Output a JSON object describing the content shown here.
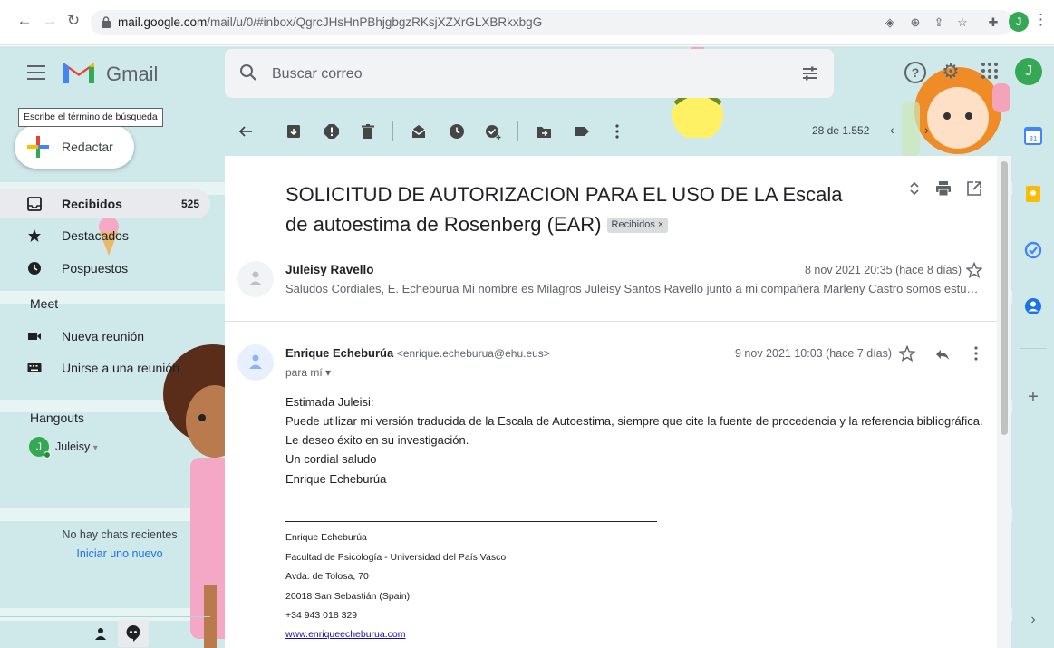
{
  "browser": {
    "url_host": "mail.google.com",
    "url_path": "/mail/u/0/#inbox/QgrcJHsHnPBhjgbgzRKsjXZXrGLXBRkxbgG",
    "profile_initial": "J"
  },
  "header": {
    "app_name": "Gmail",
    "search_placeholder": "Buscar correo",
    "account_initial": "J"
  },
  "tooltip": "Escribe el término de búsqueda",
  "compose": {
    "label": "Redactar"
  },
  "sidebar": {
    "items": [
      {
        "label": "Recibidos",
        "count": "525",
        "active": true,
        "icon": "inbox-icon"
      },
      {
        "label": "Destacados",
        "icon": "star-icon"
      },
      {
        "label": "Pospuestos",
        "icon": "clock-icon"
      }
    ],
    "meet_title": "Meet",
    "meet_items": [
      {
        "label": "Nueva reunión",
        "icon": "video-icon"
      },
      {
        "label": "Unirse a una reunión",
        "icon": "keyboard-icon"
      }
    ],
    "hangouts_title": "Hangouts",
    "hangouts_user": {
      "initial": "J",
      "name": "Juleisy",
      "caret": "▾"
    },
    "no_chats": "No hay chats recientes",
    "start_new": "Iniciar uno nuevo"
  },
  "toolbar": {
    "counter": "28 de 1.552",
    "icons": [
      "back-arrow-icon",
      "archive-icon",
      "report-spam-icon",
      "delete-icon",
      "mark-unread-icon",
      "snooze-icon",
      "add-task-icon",
      "move-to-icon",
      "label-icon",
      "more-vert-icon"
    ]
  },
  "message": {
    "subject": "SOLICITUD DE AUTORIZACION PARA EL USO DE LA Escala de autoestima de Rosenberg (EAR)",
    "label_chip": "Recibidos ×",
    "first": {
      "sender": "Juleisy Ravello",
      "date": "8 nov 2021 20:35 (hace 8 días)",
      "snippet": "Saludos Cordiales, E. Echeburua Mi nombre es Milagros Juleisy Santos Ravello junto a mi compañera Marleny Castro somos estudiantes de psicología y estamos realizando nuestra investigación"
    },
    "second": {
      "sender": "Enrique Echeburúa",
      "email": "<enrique.echeburua@ehu.eus>",
      "date": "9 nov 2021 10:03 (hace 7 días)",
      "to": "para mí ▾",
      "body": [
        "Estimada Juleisi:",
        "Puede utilizar mi versión traducida de la Escala de Autoestima, siempre que cite la fuente de procedencia y la referencia bibliográfica.",
        "Le deseo éxito en su investigación.",
        "Un cordial saludo",
        "Enrique Echeburúa"
      ],
      "signature": [
        "Enrique Echeburúa",
        "Facultad de Psicología - Universidad del País Vasco",
        "Avda. de Tolosa, 70",
        "20018 San Sebastián (Spain)",
        "+34 943 018 329"
      ],
      "signature_link": "www.enriqueecheburua.com"
    }
  },
  "colors": {
    "theme_bg": "#cfe9ea",
    "accent_blue": "#1a73e8",
    "avatar_green": "#34a853",
    "gmail_red": "#ea4335"
  }
}
